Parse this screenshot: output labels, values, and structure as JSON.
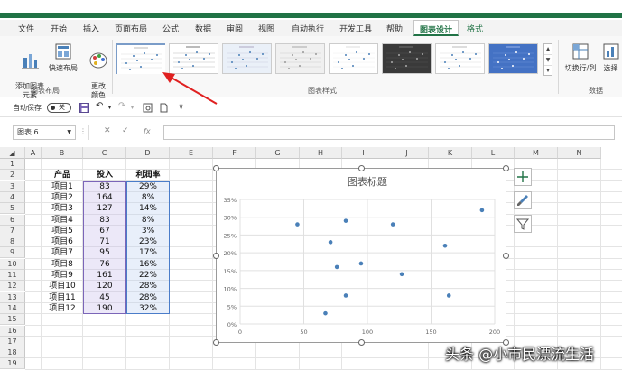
{
  "ribbon": {
    "tabs": [
      {
        "label": "文件"
      },
      {
        "label": "开始"
      },
      {
        "label": "插入"
      },
      {
        "label": "页面布局"
      },
      {
        "label": "公式"
      },
      {
        "label": "数据"
      },
      {
        "label": "审阅"
      },
      {
        "label": "视图"
      },
      {
        "label": "自动执行"
      },
      {
        "label": "开发工具"
      },
      {
        "label": "帮助"
      },
      {
        "label": "图表设计"
      },
      {
        "label": "格式"
      }
    ],
    "add_element_label": "添加图表\n元素",
    "quick_layout_label": "快速布局",
    "change_color_label": "更改\n颜色",
    "layout_group_label": "图表布局",
    "styles_group_label": "图表样式",
    "switch_row_col_label": "切换行/列",
    "select_data_label": "选择",
    "data_group_label": "数据"
  },
  "qat": {
    "autosave_label": "自动保存",
    "autosave_state": "关"
  },
  "formula_bar": {
    "name_box": "图表 6",
    "cancel": "✕",
    "enter": "✓",
    "fx": "fx"
  },
  "sheet": {
    "columns": [
      "A",
      "B",
      "C",
      "D",
      "E",
      "F",
      "G",
      "H",
      "I",
      "J",
      "K",
      "L",
      "M",
      "N"
    ],
    "rows": [
      "1",
      "2",
      "3",
      "4",
      "5",
      "6",
      "7",
      "8",
      "9",
      "10",
      "11",
      "12",
      "13",
      "14",
      "15",
      "16",
      "17",
      "18",
      "19"
    ],
    "headers": [
      "产品",
      "投入",
      "利润率"
    ],
    "data": [
      [
        "项目1",
        "83",
        "29%"
      ],
      [
        "项目2",
        "164",
        "8%"
      ],
      [
        "项目3",
        "127",
        "14%"
      ],
      [
        "项目4",
        "83",
        "8%"
      ],
      [
        "项目5",
        "67",
        "3%"
      ],
      [
        "项目6",
        "71",
        "23%"
      ],
      [
        "项目7",
        "95",
        "17%"
      ],
      [
        "项目8",
        "76",
        "16%"
      ],
      [
        "项目9",
        "161",
        "22%"
      ],
      [
        "项目10",
        "120",
        "28%"
      ],
      [
        "项目11",
        "45",
        "28%"
      ],
      [
        "项目12",
        "190",
        "32%"
      ]
    ]
  },
  "chart_data": {
    "type": "scatter",
    "title": "图表标题",
    "x": [
      83,
      164,
      127,
      83,
      67,
      71,
      95,
      76,
      161,
      120,
      45,
      190
    ],
    "y": [
      0.29,
      0.08,
      0.14,
      0.08,
      0.03,
      0.23,
      0.17,
      0.16,
      0.22,
      0.28,
      0.28,
      0.32
    ],
    "xlim": [
      0,
      200
    ],
    "ylim": [
      0,
      0.35
    ],
    "x_ticks": [
      "0",
      "50",
      "100",
      "150",
      "200"
    ],
    "y_ticks": [
      "0%",
      "5%",
      "10%",
      "15%",
      "20%",
      "25%",
      "30%",
      "35%"
    ],
    "grid": true,
    "marker_color": "#4a80b8"
  },
  "watermark": "头条 @小市民漂流生活",
  "colors": {
    "accent": "#217346",
    "annotation_arrow": "#e02020"
  }
}
